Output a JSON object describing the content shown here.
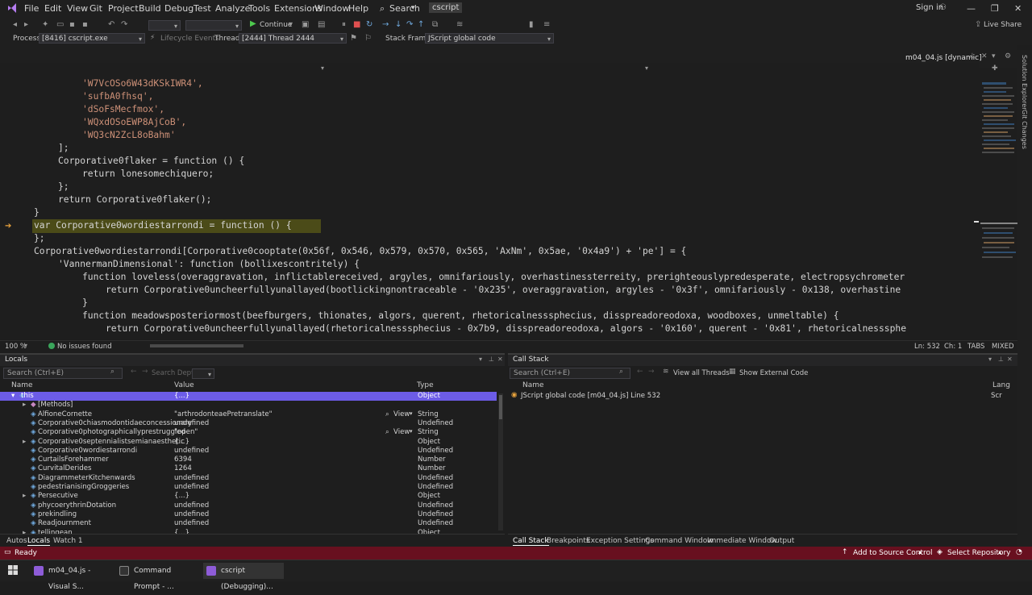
{
  "menu": {
    "items": [
      "File",
      "Edit",
      "View",
      "Git",
      "Project",
      "Build",
      "Debug",
      "Test",
      "Analyze",
      "Tools",
      "Extensions",
      "Window",
      "Help"
    ],
    "search_label": "Search",
    "search_arrow": "▾",
    "solution_name": "cscript",
    "sign_in": "Sign in"
  },
  "toolbar": {
    "continue_label": "Continue",
    "live_share": "Live Share",
    "process_label": "Process:",
    "process_value": "[8416] cscript.exe",
    "lifecycle_label": "Lifecycle Events",
    "thread_label": "Thread:",
    "thread_value": "[2444] Thread 2444",
    "stack_frame_label": "Stack Frame:",
    "stack_frame_value": "JScript global code"
  },
  "doc_tab": {
    "title": "m04_04.js [dynamic]"
  },
  "editor": {
    "zoom": "100 %",
    "issues": "No issues found",
    "ln": "Ln: 532",
    "ch": "Ch: 1",
    "tabs": "TABS",
    "mixed": "MIXED"
  },
  "code_lines": [
    {
      "t": "'W7VcOSo6W43dKSkIWR4',"
    },
    {
      "t": "'sufbA0fhsq',"
    },
    {
      "t": "'dSoFsMecfmox',"
    },
    {
      "t": "'WQxdOSoEWP8AjCoB',"
    },
    {
      "t": "'WQ3cN2ZcL8oBahm'"
    },
    {
      "t": "];"
    },
    {
      "t": "Corporative0flaker = function () {"
    },
    {
      "t": "return lonesomechiquero;"
    },
    {
      "t": "};"
    },
    {
      "t": "return Corporative0flaker();"
    },
    {
      "t": "}"
    },
    {
      "t": "var Corporative0wordiestarrondi = function () {"
    },
    {
      "t": "};"
    },
    {
      "t": "Corporative0wordiestarrondi[Corporative0cooptate(0x56f, 0x546, 0x579, 0x570, 0x565, 'AxNm', 0x5ae, '0x4a9') + 'pe'] = {"
    },
    {
      "t": "'VannermanDimensional': function (bollixescontritely) {"
    },
    {
      "t": "function loveless(overaggravation, inflictablereceived, argyles, omnifariously, overhastinessterreity, prerighteouslypredesperate, electropsychrometer"
    },
    {
      "t": "return Corporative0uncheerfullyunallayed(bootlickingnontraceable - '0x235', overaggravation, argyles - '0x3f', omnifariously - 0x138, overhastine"
    },
    {
      "t": "}"
    },
    {
      "t": "function meadowsposteriormost(beefburgers, thionates, algors, querent, rhetoricalnesssphecius, disspreadoreodoxa, woodboxes, unmeltable) {"
    },
    {
      "t": "return Corporative0uncheerfullyunallayed(rhetoricalnesssphecius - 0x7b9, disspreadoreodoxa, algors - '0x160', querent - '0x81', rhetoricalnesssphe"
    }
  ],
  "locals": {
    "title": "Locals",
    "search_placeholder": "Search (Ctrl+E)",
    "search_depth": "Search Depth:",
    "col_name": "Name",
    "col_value": "Value",
    "col_type": "Type",
    "view_label": "View",
    "rows": [
      {
        "name": "this",
        "value": "{...}",
        "type": "Object"
      },
      {
        "name": "[Methods]",
        "value": "",
        "type": ""
      },
      {
        "name": "AlfioneCornette",
        "value": "\"arthrodonteaePretranslate\"",
        "type": "String"
      },
      {
        "name": "Corporative0chiasmodontidaeconcessionary",
        "value": "undefined",
        "type": "Undefined"
      },
      {
        "name": "Corporative0photographicallyprestruggled",
        "value": "\"open\"",
        "type": "String"
      },
      {
        "name": "Corporative0septennialistsemianaesthetic",
        "value": "{...}",
        "type": "Object"
      },
      {
        "name": "Corporative0wordiestarrondi",
        "value": "undefined",
        "type": "Undefined"
      },
      {
        "name": "CurtailsForehammer",
        "value": "6394",
        "type": "Number"
      },
      {
        "name": "CurvitalDerides",
        "value": "1264",
        "type": "Number"
      },
      {
        "name": "DiagrammeterKitchenwards",
        "value": "undefined",
        "type": "Undefined"
      },
      {
        "name": "pedestrianisingGroggeries",
        "value": "undefined",
        "type": "Undefined"
      },
      {
        "name": "Persecutive",
        "value": "{...}",
        "type": "Object"
      },
      {
        "name": "phycoerythrinDotation",
        "value": "undefined",
        "type": "Undefined"
      },
      {
        "name": "prekindling",
        "value": "undefined",
        "type": "Undefined"
      },
      {
        "name": "Readjournment",
        "value": "undefined",
        "type": "Undefined"
      },
      {
        "name": "tellingean",
        "value": "{...}",
        "type": "Object"
      }
    ]
  },
  "bottom_left_tabs": [
    "Autos",
    "Locals",
    "Watch 1"
  ],
  "callstack": {
    "title": "Call Stack",
    "search_placeholder": "Search (Ctrl+E)",
    "view_all_threads": "View all Threads",
    "show_external": "Show External Code",
    "col_name": "Name",
    "col_lang": "Lang",
    "row": "JScript global code [m04_04.js] Line 532",
    "row_lang": "Scr"
  },
  "bottom_right_tabs": [
    "Call Stack",
    "Breakpoints",
    "Exception Settings",
    "Command Window",
    "Immediate Window",
    "Output"
  ],
  "status": {
    "ready": "Ready",
    "add_source": "Add to Source Control",
    "select_repo": "Select Repository"
  },
  "taskbar": {
    "items": [
      "m04_04.js - Visual S...",
      "Command Prompt - ...",
      "cscript (Debugging)..."
    ]
  },
  "colors": {
    "status_bar": "#68101f",
    "selection": "#6c5ce7",
    "highlight_line": "#4b4b18"
  }
}
